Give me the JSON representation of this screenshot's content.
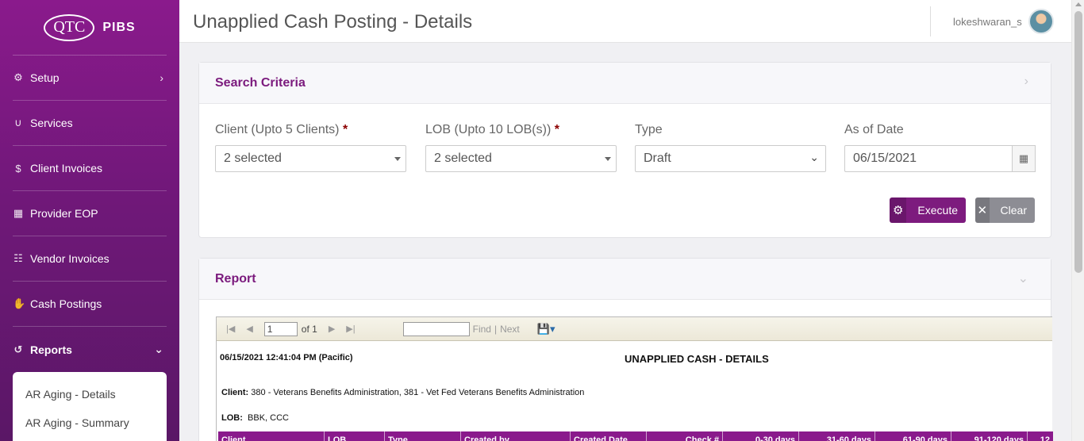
{
  "brand": {
    "logo": "QTC",
    "name": "PIBS"
  },
  "sidebar": {
    "items": [
      {
        "label": "Setup",
        "icon": "gear-icon",
        "has_chevron": true,
        "chevron": "›"
      },
      {
        "label": "Services",
        "icon": "stethoscope-icon"
      },
      {
        "label": "Client Invoices",
        "icon": "dollar-icon"
      },
      {
        "label": "Provider EOP",
        "icon": "calendar-icon"
      },
      {
        "label": "Vendor Invoices",
        "icon": "table-icon"
      },
      {
        "label": "Cash Postings",
        "icon": "hand-money-icon"
      },
      {
        "label": "Reports",
        "icon": "history-icon",
        "has_chevron": true,
        "chevron": "⌄",
        "active": true
      }
    ],
    "submenu": [
      {
        "label": "AR Aging - Details"
      },
      {
        "label": "AR Aging - Summary"
      }
    ]
  },
  "header": {
    "title": "Unapplied Cash Posting - Details",
    "username": "lokeshwaran_s"
  },
  "search": {
    "title": "Search Criteria",
    "fields": {
      "client": {
        "label": "Client (Upto 5 Clients)",
        "required_mark": "*",
        "value": "2 selected"
      },
      "lob": {
        "label": "LOB (Upto 10 LOB(s))",
        "required_mark": "*",
        "value": "2 selected"
      },
      "type": {
        "label": "Type",
        "value": "Draft"
      },
      "as_of_date": {
        "label": "As of Date",
        "value": "06/15/2021"
      }
    },
    "buttons": {
      "execute": "Execute",
      "clear": "Clear"
    }
  },
  "report": {
    "title": "Report",
    "toolbar": {
      "page_value": "1",
      "of_text": "of 1",
      "find_label": "Find",
      "separator": "|",
      "next_label": "Next"
    },
    "timestamp": "06/15/2021 12:41:04 PM (Pacific)",
    "report_title": "UNAPPLIED CASH - DETAILS",
    "client_label": "Client:",
    "client_value": "380 - Veterans Benefits Administration, 381 - Vet Fed Veterans Benefits Administration",
    "lob_label": "LOB:",
    "lob_value": "BBK, CCC",
    "columns": [
      "Client",
      "LOB",
      "Type",
      "Created by",
      "Created Date",
      "Check #",
      "0-30 days",
      "31-60 days",
      "61-90 days",
      "91-120 days",
      "12"
    ]
  },
  "colors": {
    "sidebar": "#7d1b7e",
    "accent": "#7b1a7d",
    "table_header": "#8a1a8c",
    "clear_button": "#8d8d94"
  }
}
